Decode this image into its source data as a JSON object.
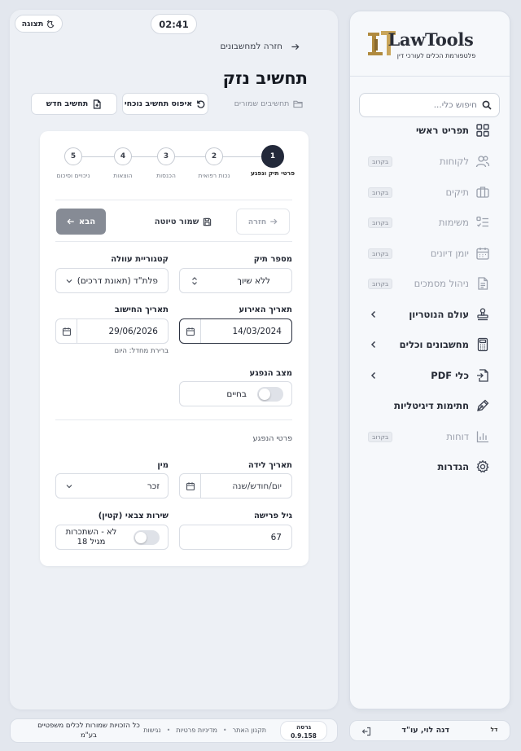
{
  "timer": "02:41",
  "display_toggle": "תצוגה",
  "back_link": "חזרה למחשבונים",
  "page_title": "תחשיב נזק",
  "actions": {
    "saved_calcs": "תחשיבים שמורים",
    "reset_calc": "איפוס תחשיב נוכחי",
    "new_calc": "תחשיב חדש"
  },
  "steps": [
    {
      "num": "1",
      "label": "פרטי תיק ונפגע",
      "active": true
    },
    {
      "num": "2",
      "label": "נכות רפואית"
    },
    {
      "num": "3",
      "label": "הכנסות"
    },
    {
      "num": "4",
      "label": "הוצאות"
    },
    {
      "num": "5",
      "label": "ניכויים וסיכום"
    }
  ],
  "nav_buttons": {
    "back": "חזרה",
    "save_draft": "שמור טיוטה",
    "next": "הבא"
  },
  "fields": {
    "case_number": {
      "label": "מספר תיק",
      "value": "ללא שיוך"
    },
    "cause_category": {
      "label": "קטגוריית עוולה",
      "value": "פלת\"ד (תאונת דרכים)"
    },
    "event_date": {
      "label": "תאריך האירוע",
      "value": "14/03/2024"
    },
    "calc_date": {
      "label": "תאריך החישוב",
      "value": "29/06/2026",
      "hint": "ברירת מחדל: היום"
    },
    "victim_status": {
      "label": "מצב הנפגע",
      "value": "בחיים"
    },
    "victim_section": "פרטי הנפגע",
    "birth_date": {
      "label": "תאריך לידה",
      "placeholder": "יום/חודש/שנה"
    },
    "gender": {
      "label": "מין",
      "value": "זכר"
    },
    "retirement_age": {
      "label": "גיל פרישה",
      "value": "67"
    },
    "military_service": {
      "label": "שירות צבאי (קטין)",
      "value": "לא - השתכרות מגיל 18"
    }
  },
  "sidebar": {
    "logo_name": "LawTools",
    "logo_sub": "פלטפורמת הכלים לעורכי דין",
    "search_placeholder": "חיפוש כלי...",
    "items": [
      {
        "label": "תפריט ראשי",
        "icon": "grid-icon"
      },
      {
        "label": "לקוחות",
        "icon": "users-icon",
        "badge": "בקרוב"
      },
      {
        "label": "תיקים",
        "icon": "briefcase-icon",
        "badge": "בקרוב"
      },
      {
        "label": "משימות",
        "icon": "tasks-icon",
        "badge": "בקרוב"
      },
      {
        "label": "יומן דיונים",
        "icon": "calendar-icon",
        "badge": "בקרוב"
      },
      {
        "label": "ניהול מסמכים",
        "icon": "document-icon",
        "badge": "בקרוב"
      },
      {
        "label": "עולם הנוטריון",
        "icon": "stamp-icon"
      },
      {
        "label": "מחשבונים וכלים",
        "icon": "calculator-icon"
      },
      {
        "label": "כלי PDF",
        "icon": "pdf-icon"
      },
      {
        "label": "חתימות דיגיטליות",
        "icon": "signature-icon"
      },
      {
        "label": "דוחות",
        "icon": "chart-icon",
        "badge": "בקרוב"
      },
      {
        "label": "הגדרות",
        "icon": "settings-icon"
      }
    ]
  },
  "user": {
    "initials": "דל",
    "name": "דנה לוי, עו\"ד"
  },
  "footer": {
    "version_label": "גרסה",
    "version": "0.9.158",
    "links": [
      "תקנון האתר",
      "מדיניות פרטיות",
      "נגישות"
    ],
    "copyright": "כל הזכויות שמורות לכלים משפטיים בע\"מ"
  }
}
